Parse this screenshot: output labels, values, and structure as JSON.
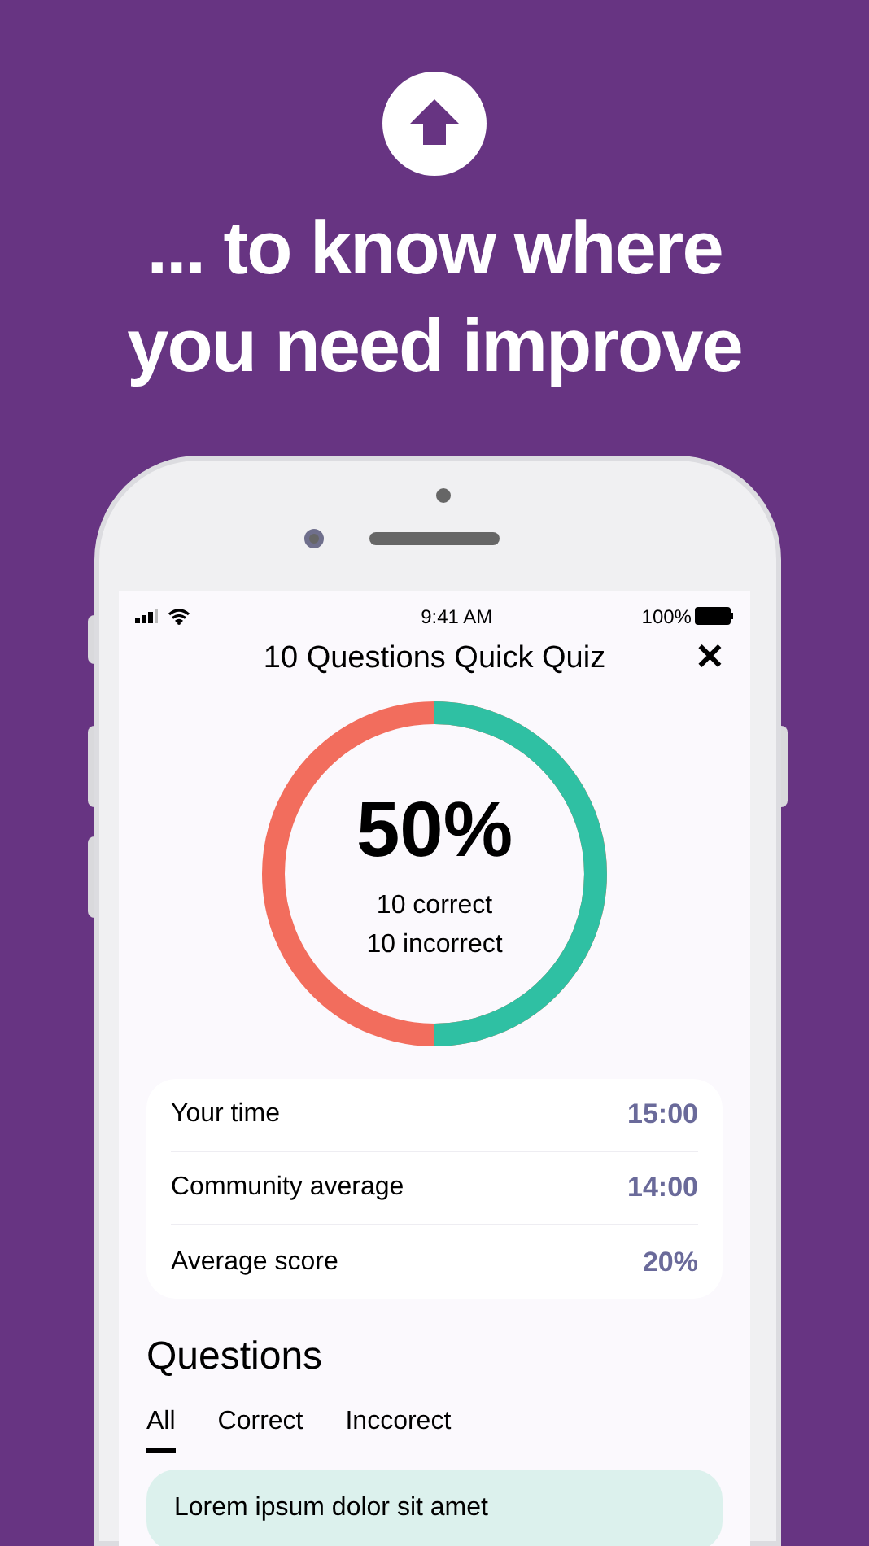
{
  "headline": {
    "lines": [
      "... to know where",
      "you need improve"
    ]
  },
  "status_bar": {
    "time": "9:41 AM",
    "battery": "100%"
  },
  "header": {
    "title": "10 Questions Quick Quiz",
    "close": "✕"
  },
  "result": {
    "level": 0.5,
    "percent": "50%",
    "correct": "10 correct",
    "incorrect": "10 incorrect"
  },
  "stats": [
    {
      "label": "Your time",
      "value": "15:00"
    },
    {
      "label": "Community average",
      "value": "14:00"
    },
    {
      "label": "Average score",
      "value": "20%"
    }
  ],
  "questions": {
    "title": "Questions",
    "tabs": [
      {
        "label": "All",
        "selected": true
      },
      {
        "label": "Correct",
        "selected": false
      },
      {
        "label": "Inccorect",
        "selected": false
      }
    ],
    "items": [
      {
        "text": "Lorem ipsum dolor sit amet"
      }
    ]
  }
}
